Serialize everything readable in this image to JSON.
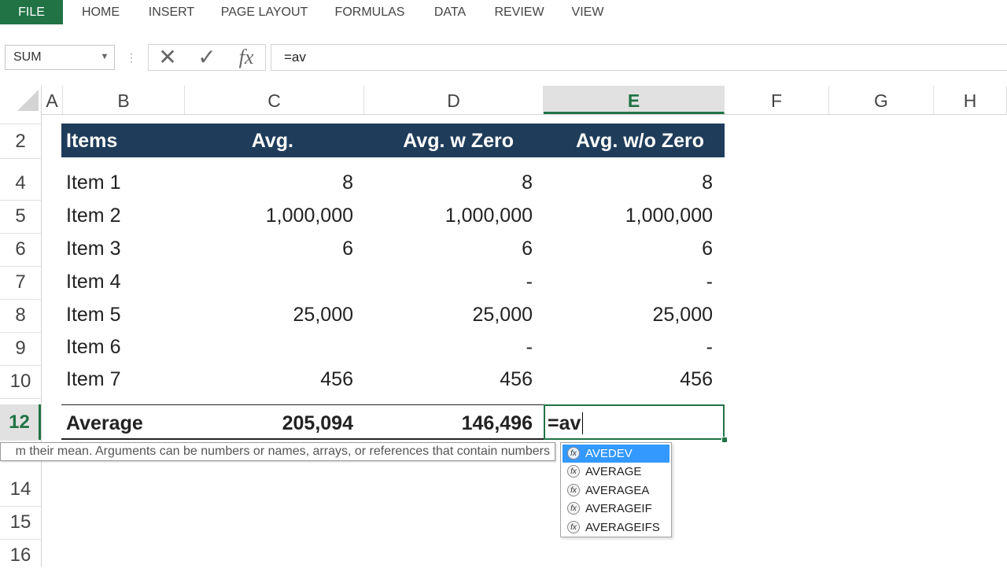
{
  "ribbon": {
    "tabs": [
      "FILE",
      "HOME",
      "INSERT",
      "PAGE LAYOUT",
      "FORMULAS",
      "DATA",
      "REVIEW",
      "VIEW"
    ]
  },
  "formula_bar": {
    "name_box": "SUM",
    "cancel_icon": "✕",
    "enter_icon": "✓",
    "fx_icon": "fx",
    "formula": "=av"
  },
  "columns": [
    "A",
    "B",
    "C",
    "D",
    "E",
    "F",
    "G",
    "H"
  ],
  "rows": [
    "2",
    "4",
    "5",
    "6",
    "7",
    "8",
    "9",
    "10",
    "12",
    "14",
    "15",
    "16"
  ],
  "table": {
    "headers": [
      "Items",
      "Avg.",
      "Avg. w Zero",
      "Avg. w/o Zero"
    ],
    "data": [
      [
        "Item 1",
        "8",
        "8",
        "8"
      ],
      [
        "Item 2",
        "1,000,000",
        "1,000,000",
        "1,000,000"
      ],
      [
        "Item 3",
        "6",
        "6",
        "6"
      ],
      [
        "Item 4",
        "",
        "-",
        "-"
      ],
      [
        "Item 5",
        "25,000",
        "25,000",
        "25,000"
      ],
      [
        "Item 6",
        "",
        "-",
        "-"
      ],
      [
        "Item 7",
        "456",
        "456",
        "456"
      ]
    ],
    "total": [
      "Average",
      "205,094",
      "146,496"
    ],
    "active_cell_text": "=av"
  },
  "tooltip": "m their mean. Arguments can be numbers or names, arrays, or references that contain numbers",
  "autocomplete": {
    "items": [
      "AVEDEV",
      "AVERAGE",
      "AVERAGEA",
      "AVERAGEIF",
      "AVERAGEIFS"
    ],
    "highlighted": 0,
    "icon": "fx"
  },
  "colors": {
    "excel_green": "#217346",
    "header_band": "#1f3c5a",
    "highlight": "#3399ff"
  }
}
